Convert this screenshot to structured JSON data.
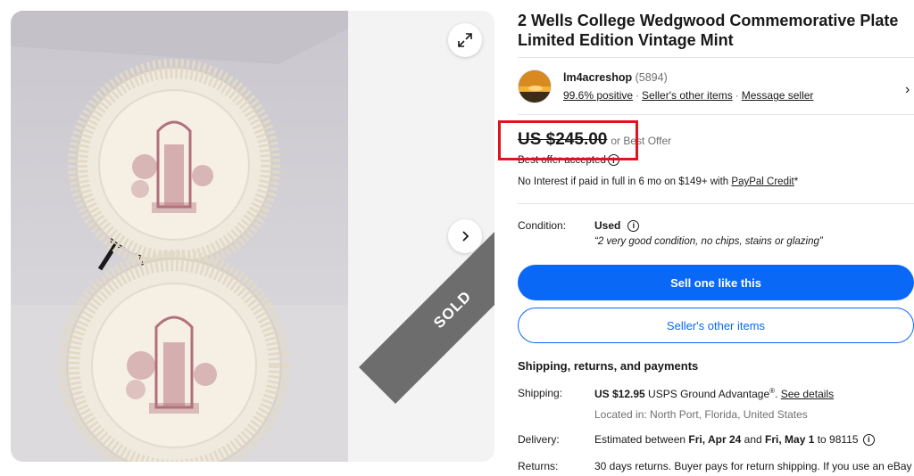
{
  "listing": {
    "title": "2 Wells College Wedgwood Commemorative Plate Limited Edition Vintage Mint",
    "sold_badge": "SOLD"
  },
  "seller": {
    "name": "lm4acreshop",
    "feedback_count": "(5894)",
    "positive": "99.6% positive",
    "other_items": "Seller's other items",
    "message": "Message seller",
    "separator": "·",
    "chevron": "›"
  },
  "pricing": {
    "price": "US $245.00",
    "or_best_offer": "or Best Offer",
    "best_offer_accepted": "Best offer accepted",
    "financing_prefix": "No Interest if paid in full in 6 mo on $149+ with ",
    "financing_link": "PayPal Credit",
    "financing_suffix": "*"
  },
  "condition": {
    "label": "Condition:",
    "value": "Used",
    "note": "“2 very good condition, no chips, stains or glazing”"
  },
  "actions": {
    "sell_like_this": "Sell one like this",
    "sellers_other_items": "Seller's other items"
  },
  "shipping": {
    "heading": "Shipping, returns, and payments",
    "shipping_label": "Shipping:",
    "shipping_cost": "US $12.95",
    "shipping_service": " USPS Ground Advantage",
    "shipping_reg": "®",
    "shipping_after": ". ",
    "see_details": "See details",
    "location": "Located in: North Port, Florida, United States",
    "delivery_label": "Delivery:",
    "delivery_prefix": "Estimated between ",
    "delivery_start": "Fri, Apr 24",
    "delivery_and": " and ",
    "delivery_end": "Fri, May 1",
    "delivery_to": " to 98115 ",
    "returns_label": "Returns:",
    "returns_text": "30 days returns. Buyer pays for return shipping. If you use an eBay"
  },
  "icons": {
    "info": "i",
    "expand": "expand-icon",
    "next": "chevron-right-icon"
  },
  "colors": {
    "primary_blue": "#0968f6",
    "highlight_red": "#e0141e",
    "sold_ribbon": "#6d6d6d"
  }
}
